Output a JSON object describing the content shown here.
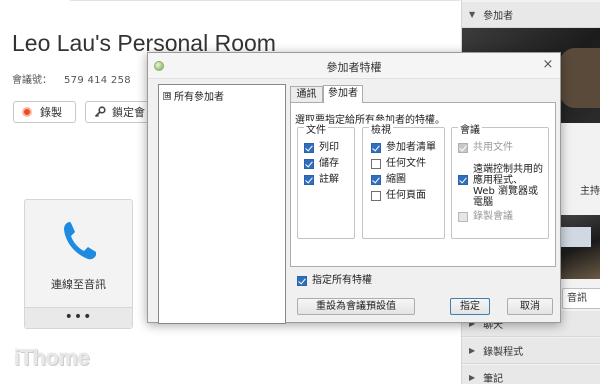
{
  "app": {
    "room_title": "Leo Lau's Personal Room",
    "meeting_number_label": "會議號：",
    "meeting_number": "579 414 258",
    "record_label": "錄製",
    "lock_label": "鎖定會",
    "audio_label": "連線至音訊",
    "more_label": "•••",
    "watermark": "iThome"
  },
  "right_panel": {
    "sections": [
      "參加者",
      "聊天",
      "錄製程式",
      "筆記"
    ],
    "host_text": "主持人, 我",
    "share_label": "音訊"
  },
  "dialog": {
    "title": "參加者特權",
    "close_label": "×",
    "tree": {
      "root_label": "所有參加者",
      "expand_symbol": "⊞"
    },
    "tabs": [
      {
        "label": "通訊",
        "active": false
      },
      {
        "label": "參加者",
        "active": true
      }
    ],
    "instruction": "選取要指定給所有參加者的特權。",
    "groups": {
      "document": {
        "title": "文件",
        "items": [
          {
            "label": "列印",
            "checked": true
          },
          {
            "label": "儲存",
            "checked": true
          },
          {
            "label": "註解",
            "checked": true
          }
        ]
      },
      "view": {
        "title": "檢視",
        "items": [
          {
            "label": "參加者清單",
            "checked": true
          },
          {
            "label": "任何文件",
            "checked": false
          },
          {
            "label": "縮圖",
            "checked": true
          },
          {
            "label": "任何頁面",
            "checked": false
          }
        ]
      },
      "meeting": {
        "title": "會議",
        "items": [
          {
            "label": "共用文件",
            "checked": true,
            "disabled": true
          },
          {
            "label": "遠端控制共用的應用程式、Web 瀏覽器或電腦",
            "checked": true,
            "disabled": false
          },
          {
            "label": "錄製會議",
            "checked": false,
            "disabled": true
          }
        ]
      }
    },
    "assign_all": {
      "label": "指定所有特權",
      "checked": true
    },
    "buttons": {
      "reset": "重設為會議預設值",
      "ok": "指定",
      "cancel": "取消"
    }
  }
}
